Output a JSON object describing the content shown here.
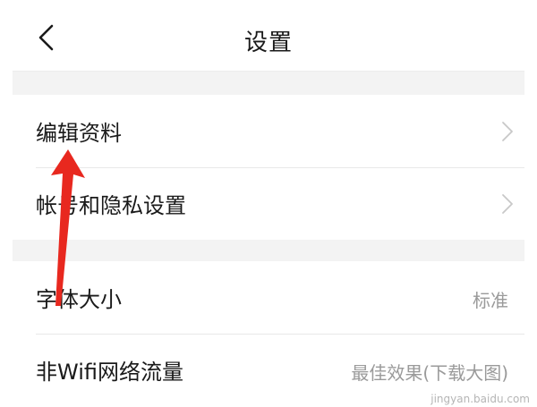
{
  "header": {
    "title": "设置",
    "back_icon": "chevron-left-icon"
  },
  "section1": {
    "items": [
      {
        "label": "编辑资料",
        "icon": "chevron-right-icon"
      },
      {
        "label": "帐号和隐私设置",
        "icon": "chevron-right-icon"
      }
    ]
  },
  "section2": {
    "items": [
      {
        "label": "字体大小",
        "value": "标准"
      },
      {
        "label": "非Wifi网络流量",
        "value": "最佳效果(下载大图)"
      }
    ]
  },
  "annotation": {
    "arrow_color": "#e8281f"
  },
  "watermark": "jingyan.baidu.com",
  "colors": {
    "background": "#ffffff",
    "section_gap": "#f3f3f3",
    "divider": "#e8e8e8",
    "text_primary": "#1a1a1a",
    "text_secondary": "#9a9a9a"
  }
}
